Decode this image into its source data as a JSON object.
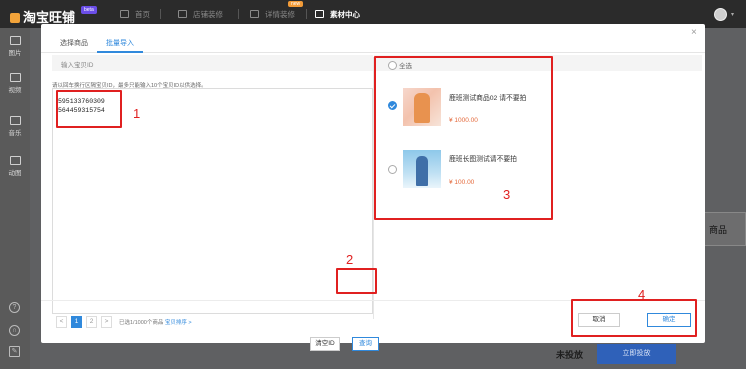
{
  "topbar": {
    "logo": "淘宝旺铺",
    "logo_badge": "beta",
    "nav": [
      {
        "label": "首页",
        "icon": "home-icon"
      },
      {
        "label": "店铺装修",
        "icon": "store-decor-icon"
      },
      {
        "label": "详情装修",
        "icon": "detail-decor-icon"
      },
      {
        "label": "素材中心",
        "icon": "material-center-icon"
      }
    ],
    "hot_badge": "new"
  },
  "sidebar": {
    "items": [
      {
        "label": "图片",
        "icon": "image-icon"
      },
      {
        "label": "视频",
        "icon": "video-icon"
      },
      {
        "label": "音乐",
        "icon": "music-icon"
      },
      {
        "label": "动图",
        "icon": "gif-icon"
      }
    ],
    "bottom_icons": [
      "help-icon",
      "headset-icon",
      "edit-icon"
    ],
    "bottom_glyphs": [
      "?",
      "∩",
      "✎"
    ]
  },
  "background": {
    "card_text": "商品",
    "status": "未投放",
    "launch_button": "立即投放"
  },
  "modal": {
    "close": "×",
    "tabs": [
      {
        "label": "选择商品",
        "active": false
      },
      {
        "label": "批量导入",
        "active": true
      }
    ],
    "input_header": "输入宝贝ID",
    "hint": "请以回车换行区隔宝贝ID，最多只能输入10个宝贝ID以供选择。",
    "ids": [
      "595133760309",
      "564459315754"
    ],
    "clear_button": "清空ID",
    "query_button": "查询",
    "select_all": "全选",
    "products": [
      {
        "name": "鹿班测试商品02 请不要拍",
        "price": "¥ 1000.00",
        "checked": true
      },
      {
        "name": "鹿班长图测试请不要拍",
        "price": "¥ 100.00",
        "checked": false
      }
    ],
    "pagination": {
      "prev": "<",
      "pages": [
        "1",
        "2"
      ],
      "current": "1",
      "next": ">",
      "info": "已选1/1000个商品",
      "info_link": "宝贝排序 >"
    },
    "cancel_button": "取消",
    "ok_button": "确定"
  },
  "annotations": [
    "1",
    "2",
    "3",
    "4"
  ],
  "colors": {
    "accent": "#3089dc",
    "price": "#e4693b",
    "annotation": "#e02020",
    "topbar": "#2b2b2b"
  }
}
